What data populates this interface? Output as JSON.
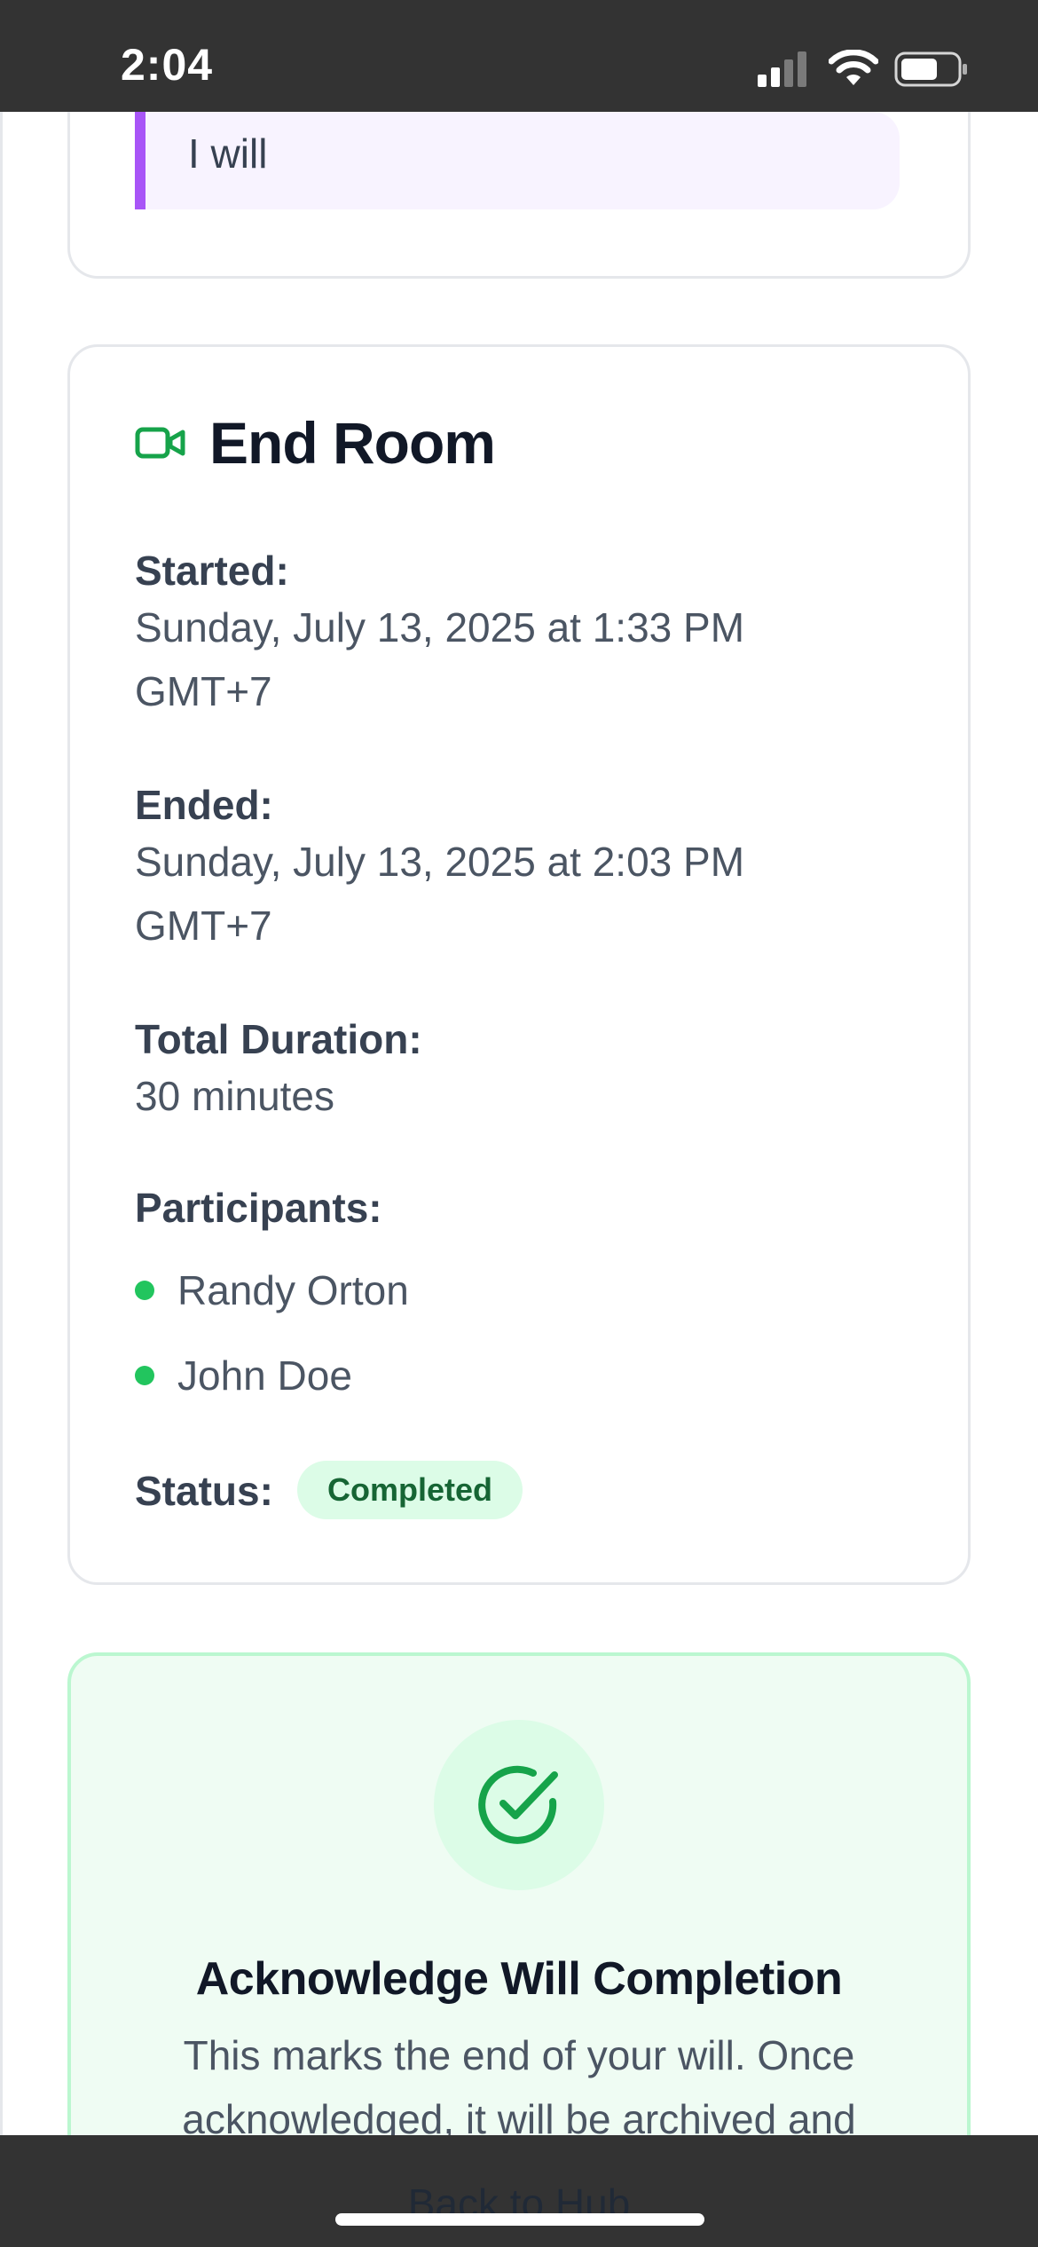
{
  "status_bar": {
    "time": "2:04"
  },
  "top_card": {
    "quote_text": "I will"
  },
  "end_room": {
    "title": "End Room",
    "started_label": "Started:",
    "started_value": "Sunday, July 13, 2025 at 1:33 PM GMT+7",
    "ended_label": "Ended:",
    "ended_value": "Sunday, July 13, 2025 at 2:03 PM GMT+7",
    "duration_label": "Total Duration:",
    "duration_value": "30 minutes",
    "participants_label": "Participants:",
    "participants": [
      "Randy Orton",
      "John Doe"
    ],
    "status_label": "Status:",
    "status_value": "Completed"
  },
  "acknowledge": {
    "title": "Acknowledge Will Completion",
    "body": "This marks the end of your will. Once acknowledged, it will be archived and"
  },
  "footer": {
    "back_link": "Back to Hub"
  },
  "colors": {
    "accent_purple": "#a855f7",
    "success_green": "#22c55e",
    "badge_bg": "#dcfce7",
    "badge_text": "#166534"
  }
}
